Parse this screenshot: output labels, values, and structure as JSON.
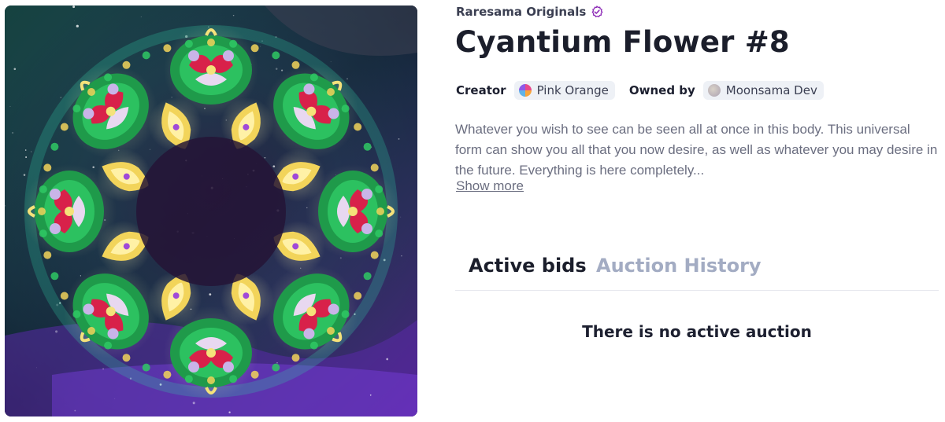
{
  "artwork": {
    "alt": "Cyantium Flower #8 artwork",
    "icon": "nft-image"
  },
  "collection": {
    "name": "Raresama Originals",
    "verified_color": "#8f2fb8"
  },
  "item": {
    "title": "Cyantium Flower #8"
  },
  "people": {
    "creator_label": "Creator",
    "creator_name": "Pink Orange",
    "owner_label": "Owned by",
    "owner_name": "Moonsama Dev"
  },
  "description": {
    "text": "Whatever you wish to see can be seen all at once in this body. This universal form can show you all that you now desire, as well as whatever you may desire in the future. Everything is here completely...",
    "show_more": "Show more"
  },
  "tabs": [
    {
      "label": "Active bids",
      "active": true
    },
    {
      "label": "Auction History",
      "active": false
    }
  ],
  "auction": {
    "empty_message": "There is no active auction"
  },
  "colors": {
    "text": "#1b1e2b",
    "muted": "#6b6e80",
    "tab_inactive": "#a3acc3",
    "chip_bg": "#eef1f6"
  }
}
